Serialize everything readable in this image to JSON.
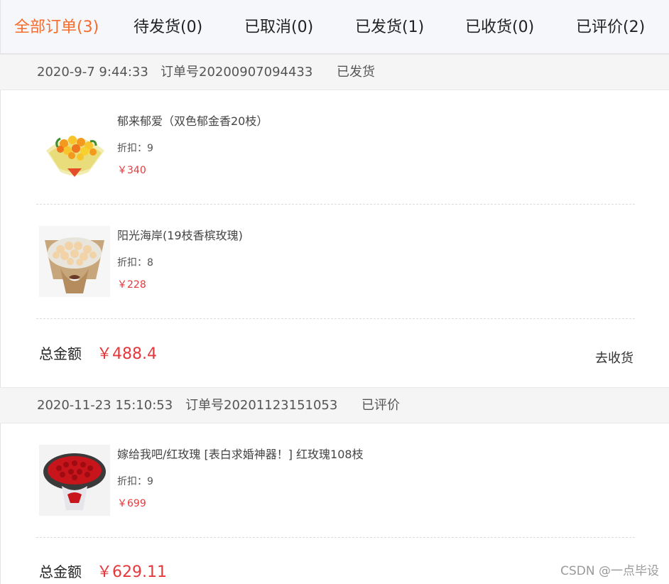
{
  "tabs": [
    {
      "label": "全部订单(3)"
    },
    {
      "label": "待发货(0)"
    },
    {
      "label": "已取消(0)"
    },
    {
      "label": "已发货(1)"
    },
    {
      "label": "已收货(0)"
    },
    {
      "label": "已评价(2)"
    }
  ],
  "orders": [
    {
      "date": "2020-9-7 9:44:33",
      "order_no": "订单号20200907094433",
      "status": "已发货",
      "items": [
        {
          "name": "郁来郁爱（双色郁金香20枝）",
          "discount": "折扣：9",
          "price": "￥340"
        },
        {
          "name": "阳光海岸(19枝香槟玫瑰)",
          "discount": "折扣：8",
          "price": "￥228"
        }
      ],
      "total_label": "总金额",
      "total_value": "￥488.4",
      "action": "去收货"
    },
    {
      "date": "2020-11-23 15:10:53",
      "order_no": "订单号20201123151053",
      "status": "已评价",
      "items": [
        {
          "name": "嫁给我吧/红玫瑰 [表白求婚神器！] 红玫瑰108枝",
          "discount": "折扣：9",
          "price": "￥699"
        }
      ],
      "total_label": "总金额",
      "total_value": "￥629.11"
    }
  ],
  "watermark": "CSDN @一点毕设"
}
